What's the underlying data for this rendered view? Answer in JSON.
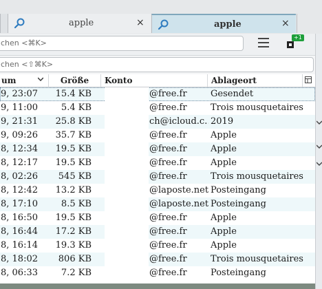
{
  "tabs": [
    {
      "label": "",
      "icon": "search-icon"
    },
    {
      "label": "apple",
      "icon": "search-icon",
      "close": "×"
    },
    {
      "label": "apple",
      "icon": "search-icon",
      "close": "×",
      "active": true
    }
  ],
  "toolbar": {
    "search_placeholder": "chen <⌘K>",
    "addon_badge": "+1"
  },
  "filter": {
    "placeholder": "chen <⇧⌘K>"
  },
  "columns": {
    "datum": "um",
    "groesse": "Größe",
    "konto": "Konto",
    "ablageort": "Ablageort"
  },
  "rows": [
    {
      "date": "9, 23:07",
      "size": "15.4 KB",
      "konto": "@free.fr",
      "folder": "Gesendet"
    },
    {
      "date": "9, 11:00",
      "size": "5.4 KB",
      "konto": "@free.fr",
      "folder": "Trois mousquetaires"
    },
    {
      "date": "9, 21:31",
      "size": "25.8 KB",
      "konto": "ch@icloud.c…",
      "folder": "2019"
    },
    {
      "date": "9, 09:26",
      "size": "35.7 KB",
      "konto": "@free.fr",
      "folder": "Apple"
    },
    {
      "date": "8, 12:34",
      "size": "19.5 KB",
      "konto": "@free.fr",
      "folder": "Apple"
    },
    {
      "date": "8, 12:17",
      "size": "19.5 KB",
      "konto": "@free.fr",
      "folder": "Apple"
    },
    {
      "date": "8, 02:26",
      "size": "545 KB",
      "konto": "@free.fr",
      "folder": "Trois mousquetaires"
    },
    {
      "date": "8, 12:42",
      "size": "13.2 KB",
      "konto": "@laposte.net",
      "folder": "Posteingang"
    },
    {
      "date": "8, 17:10",
      "size": "8.5 KB",
      "konto": "@laposte.net",
      "folder": "Posteingang"
    },
    {
      "date": "8, 16:50",
      "size": "19.5 KB",
      "konto": "@free.fr",
      "folder": "Apple"
    },
    {
      "date": "8, 16:44",
      "size": "17.2 KB",
      "konto": "@free.fr",
      "folder": "Apple"
    },
    {
      "date": "8, 16:14",
      "size": "19.3 KB",
      "konto": "@free.fr",
      "folder": "Apple"
    },
    {
      "date": "8, 18:02",
      "size": "806 KB",
      "konto": "@free.fr",
      "folder": "Trois mousquetaires"
    },
    {
      "date": "8, 06:33",
      "size": "7.2 KB",
      "konto": "@free.fr",
      "folder": "Posteingang"
    }
  ],
  "colors": {
    "row_alt": "#eef8fa",
    "active_tab": "#cfe3ec",
    "accent_icon": "#2e7bbf",
    "addon_green": "#1e9f3b"
  }
}
